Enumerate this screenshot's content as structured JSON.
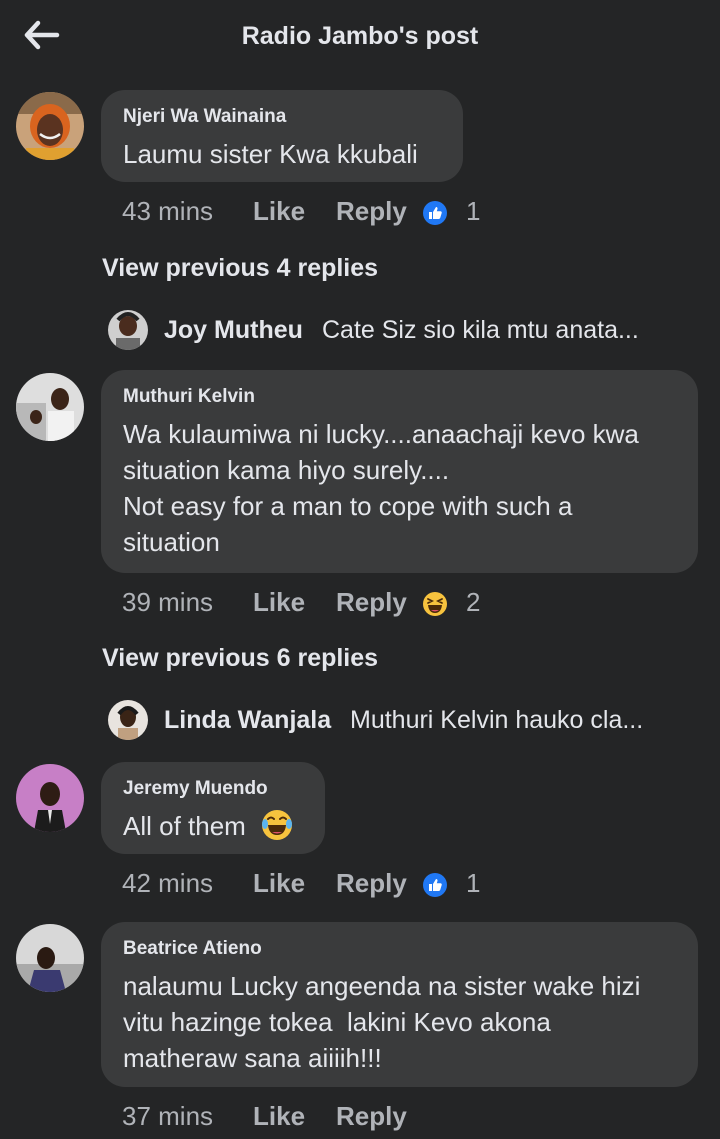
{
  "header": {
    "title": "Radio Jambo's post",
    "back_icon": "arrow-left-icon"
  },
  "comments": [
    {
      "author": "Njeri Wa Wainaina",
      "lines": [
        "Laumu sister Kwa kkubali"
      ],
      "time": "43 mins",
      "like": "Like",
      "reply": "Reply",
      "reaction": "thumbs-up-icon",
      "reaction_count": "1"
    },
    {
      "author": "Muthuri Kelvin",
      "lines": [
        "Wa kulaumiwa ni lucky....anaachaji kevo kwa",
        "situation kama hiyo surely....",
        "Not easy for a man to cope with such a",
        "situation"
      ],
      "time": "39 mins",
      "like": "Like",
      "reply": "Reply",
      "reaction": "laughing-emoji-icon",
      "reaction_count": "2"
    },
    {
      "author": "Jeremy Muendo",
      "lines": [
        "All of them"
      ],
      "emoji": "tears-of-joy-emoji-icon",
      "time": "42 mins",
      "like": "Like",
      "reply": "Reply",
      "reaction": "thumbs-up-icon",
      "reaction_count": "1"
    },
    {
      "author": "Beatrice Atieno",
      "lines": [
        "nalaumu Lucky angeenda na sister wake hizi",
        "vitu hazinge tokea  lakini Kevo akona",
        "matheraw sana aiiiih!!!"
      ],
      "time": "37 mins",
      "like": "Like",
      "reply": "Reply"
    }
  ],
  "view_previous": [
    "View previous 4 replies",
    "View previous 6 replies"
  ],
  "reply_previews": [
    {
      "name": "Joy Mutheu",
      "text": "Cate Siz sio kila mtu anata..."
    },
    {
      "name": "Linda Wanjala",
      "text": "Muthuri Kelvin hauko cla..."
    }
  ],
  "colors": {
    "background": "#242526",
    "bubble": "#3a3b3c",
    "text": "#e4e6eb",
    "muted": "#b0b3b8",
    "like_blue": "#2078f4",
    "haha_yellow": "#f7c33e"
  }
}
